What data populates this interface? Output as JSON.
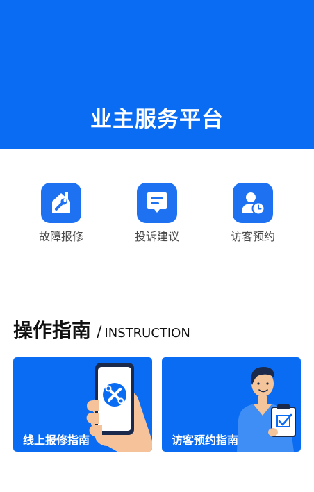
{
  "header": {
    "title": "业主服务平台"
  },
  "quick_actions": [
    {
      "label": "故障报修",
      "icon": "house-repair-icon"
    },
    {
      "label": "投诉建议",
      "icon": "message-icon"
    },
    {
      "label": "访客预约",
      "icon": "visitor-clock-icon"
    }
  ],
  "guide": {
    "title_cn": "操作指南",
    "separator": "/",
    "title_en": "INSTRUCTION",
    "cards": [
      {
        "label": "线上报修指南",
        "icon": "phone-tools-icon"
      },
      {
        "label": "访客预约指南",
        "icon": "person-checklist-icon"
      }
    ]
  },
  "colors": {
    "primary": "#0A6CF2",
    "icon_bg": "#1E72F2"
  }
}
